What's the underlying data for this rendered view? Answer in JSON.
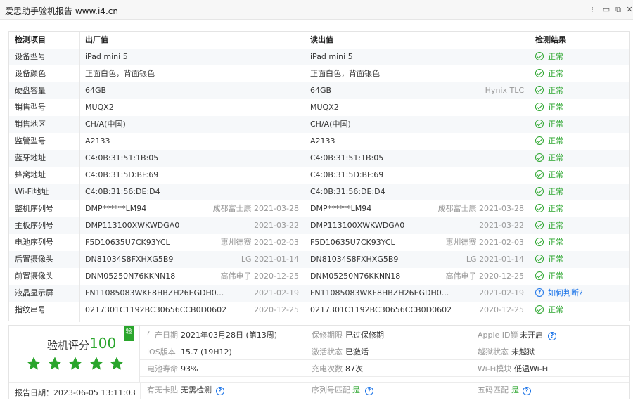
{
  "window": {
    "title": "爱思助手验机报告 www.i4.cn",
    "controls": [
      "⁝",
      "▭",
      "⧉",
      "✕"
    ]
  },
  "table": {
    "headers": [
      "检测项目",
      "出厂值",
      "读出值",
      "检测结果"
    ],
    "rows": [
      {
        "item": "设备型号",
        "factory": "iPad mini 5",
        "factory_meta": "",
        "read": "iPad mini 5",
        "read_meta": "",
        "result": "正常",
        "ok": true
      },
      {
        "item": "设备颜色",
        "factory": "正面白色，背面银色",
        "factory_meta": "",
        "read": "正面白色，背面银色",
        "read_meta": "",
        "result": "正常",
        "ok": true
      },
      {
        "item": "硬盘容量",
        "factory": "64GB",
        "factory_meta": "",
        "read": "64GB",
        "read_meta": "Hynix TLC",
        "result": "正常",
        "ok": true
      },
      {
        "item": "销售型号",
        "factory": "MUQX2",
        "factory_meta": "",
        "read": "MUQX2",
        "read_meta": "",
        "result": "正常",
        "ok": true
      },
      {
        "item": "销售地区",
        "factory": "CH/A(中国)",
        "factory_meta": "",
        "read": "CH/A(中国)",
        "read_meta": "",
        "result": "正常",
        "ok": true
      },
      {
        "item": "监管型号",
        "factory": "A2133",
        "factory_meta": "",
        "read": "A2133",
        "read_meta": "",
        "result": "正常",
        "ok": true
      },
      {
        "item": "蓝牙地址",
        "factory": "C4:0B:31:51:1B:05",
        "factory_meta": "",
        "read": "C4:0B:31:51:1B:05",
        "read_meta": "",
        "result": "正常",
        "ok": true
      },
      {
        "item": "蜂窝地址",
        "factory": "C4:0B:31:5D:BF:69",
        "factory_meta": "",
        "read": "C4:0B:31:5D:BF:69",
        "read_meta": "",
        "result": "正常",
        "ok": true
      },
      {
        "item": "Wi-Fi地址",
        "factory": "C4:0B:31:56:DE:D4",
        "factory_meta": "",
        "read": "C4:0B:31:56:DE:D4",
        "read_meta": "",
        "result": "正常",
        "ok": true
      },
      {
        "item": "整机序列号",
        "factory": "DMP******LM94",
        "factory_meta": "成都富士康  2021-03-28",
        "read": "DMP******LM94",
        "read_meta": "成都富士康  2021-03-28",
        "result": "正常",
        "ok": true
      },
      {
        "item": "主板序列号",
        "factory": "DMP113100XWKWDGA0",
        "factory_meta": "2021-03-22",
        "read": "DMP113100XWKWDGA0",
        "read_meta": "2021-03-22",
        "result": "正常",
        "ok": true
      },
      {
        "item": "电池序列号",
        "factory": "F5D10635U7CK93YCL",
        "factory_meta": "惠州德赛  2021-02-03",
        "read": "F5D10635U7CK93YCL",
        "read_meta": "惠州德赛  2021-02-03",
        "result": "正常",
        "ok": true
      },
      {
        "item": "后置摄像头",
        "factory": "DN81034S8FXHXG5B9",
        "factory_meta": "LG  2021-01-14",
        "read": "DN81034S8FXHXG5B9",
        "read_meta": "LG  2021-01-14",
        "result": "正常",
        "ok": true
      },
      {
        "item": "前置摄像头",
        "factory": "DNM05250N76KKNN18",
        "factory_meta": "高伟电子  2020-12-25",
        "read": "DNM05250N76KKNN18",
        "read_meta": "高伟电子  2020-12-25",
        "result": "正常",
        "ok": true
      },
      {
        "item": "液晶显示屏",
        "factory": "FN11085083WKF8HBZH26EGDH0...",
        "factory_meta": "2021-02-19",
        "read": "FN11085083WKF8HBZH26EGDH0...",
        "read_meta": "2021-02-19",
        "result": "如何判断?",
        "ok": false
      },
      {
        "item": "指纹串号",
        "factory": "0217301C1192BC30656CCB0D060200CD",
        "factory_meta": "2020-12-25",
        "read": "0217301C1192BC30656CCB0D060200CD",
        "read_meta": "2020-12-25",
        "result": "正常",
        "ok": true
      }
    ]
  },
  "summary": {
    "badge": "验",
    "score_label": "验机评分",
    "score": "100",
    "stars": 5,
    "report_date": "报告日期：2023-06-05 13:11:03"
  },
  "info": {
    "production_date": {
      "k": "生产日期",
      "v": "2021年03月28日 (第13周)"
    },
    "warranty": {
      "k": "保修期限",
      "v": "已过保修期"
    },
    "apple_id": {
      "k": "Apple ID锁",
      "v": "未开启"
    },
    "ios": {
      "k": "iOS版本",
      "v": "15.7 (19H12)"
    },
    "activation": {
      "k": "激活状态",
      "v": "已激活"
    },
    "jailbreak": {
      "k": "越狱状态",
      "v": "未越狱"
    },
    "battery": {
      "k": "电池寿命",
      "v": "93%"
    },
    "charge": {
      "k": "充电次数",
      "v": "87次"
    },
    "wifi": {
      "k": "Wi-Fi模块",
      "v": "低温Wi-Fi"
    },
    "sim": {
      "k": "有无卡贴",
      "v": "无需检测"
    },
    "serial_match": {
      "k": "序列号匹配",
      "v": "是"
    },
    "five_code": {
      "k": "五码匹配",
      "v": "是"
    }
  },
  "colors": {
    "ok": "#2aa52c",
    "link": "#1a73e8",
    "alt_row": "#f6f8fa"
  }
}
